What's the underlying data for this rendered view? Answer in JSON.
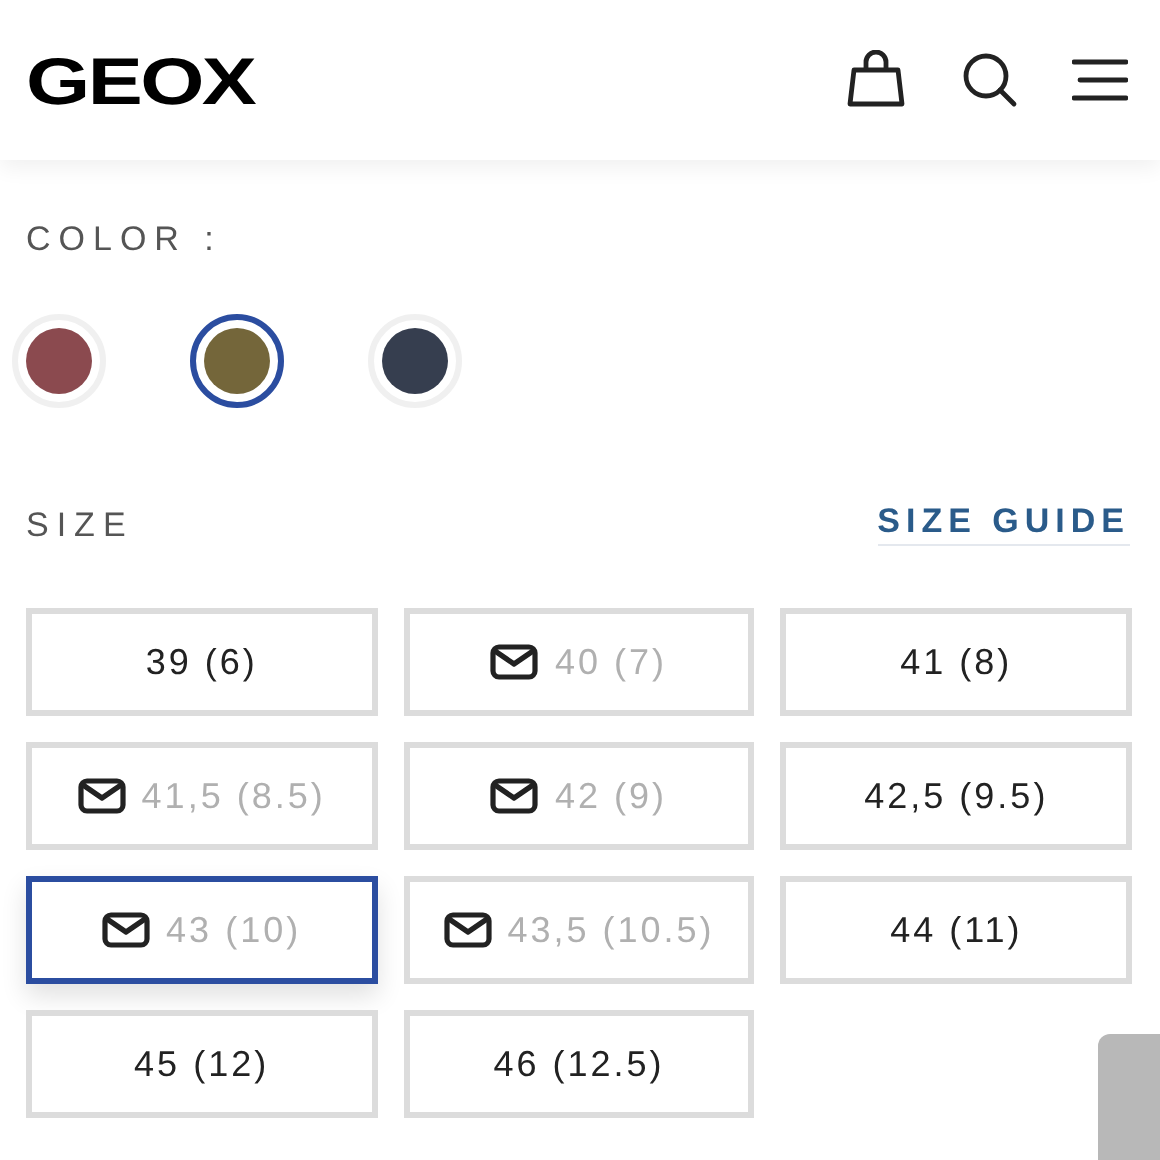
{
  "header": {
    "logo": "GEOX"
  },
  "color_section": {
    "label": "COLOR :",
    "swatches": [
      {
        "color": "#8b4a4f",
        "selected": false
      },
      {
        "color": "#74663a",
        "selected": true
      },
      {
        "color": "#363e4f",
        "selected": false
      }
    ]
  },
  "size_section": {
    "label": "SIZE",
    "guide_link": "SIZE GUIDE",
    "sizes": [
      {
        "label": "39 (6)",
        "available": true,
        "selected": false
      },
      {
        "label": "40 (7)",
        "available": false,
        "selected": false
      },
      {
        "label": "41 (8)",
        "available": true,
        "selected": false
      },
      {
        "label": "41,5 (8.5)",
        "available": false,
        "selected": false
      },
      {
        "label": "42 (9)",
        "available": false,
        "selected": false
      },
      {
        "label": "42,5 (9.5)",
        "available": true,
        "selected": false
      },
      {
        "label": "43 (10)",
        "available": false,
        "selected": true
      },
      {
        "label": "43,5 (10.5)",
        "available": false,
        "selected": false
      },
      {
        "label": "44 (11)",
        "available": true,
        "selected": false
      },
      {
        "label": "45 (12)",
        "available": true,
        "selected": false
      },
      {
        "label": "46 (12.5)",
        "available": true,
        "selected": false
      }
    ]
  }
}
